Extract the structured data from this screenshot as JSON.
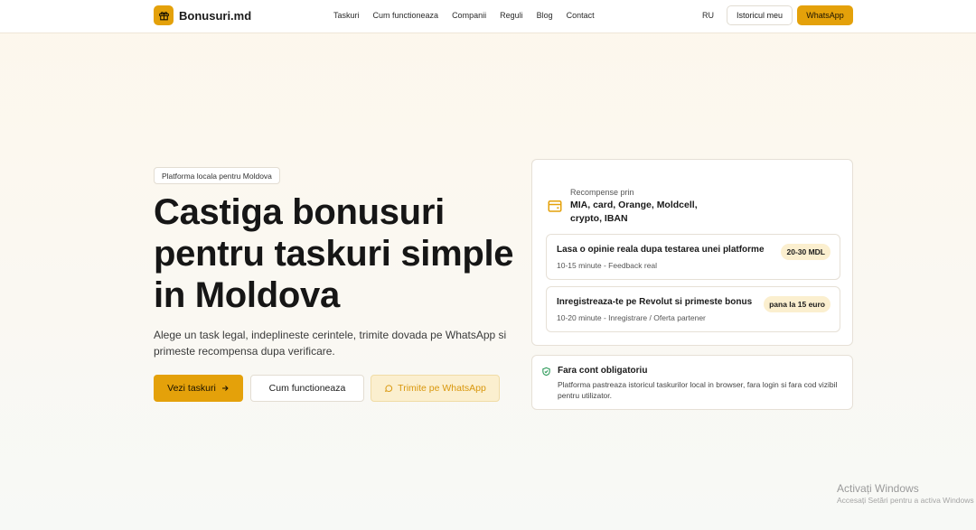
{
  "brand": {
    "name": "Bonusuri.md",
    "icon": "gift-icon",
    "accent": "#e4a10a"
  },
  "nav": {
    "items": [
      "Taskuri",
      "Cum functioneaza",
      "Companii",
      "Reguli",
      "Blog",
      "Contact"
    ],
    "lang": "RU",
    "history_label": "Istoricul meu",
    "whatsapp_label": "WhatsApp"
  },
  "hero": {
    "badge": "Platforma locala pentru Moldova",
    "title": "Castiga bonusuri pentru taskuri simple in Moldova",
    "subtitle": "Alege un task legal, indeplineste cerintele, trimite dovada pe WhatsApp si primeste recompensa dupa verificare.",
    "cta_primary": "Vezi taskuri",
    "cta_secondary": "Cum functioneaza",
    "cta_whatsapp": "Trimite pe WhatsApp"
  },
  "rewards": {
    "icon": "wallet-icon",
    "label": "Recompense prin",
    "methods": "MIA, card, Orange, Moldcell, crypto, IBAN"
  },
  "tasks": [
    {
      "title": "Lasa o opinie reala dupa testarea unei platforme",
      "meta": "10-15 minute - Feedback real",
      "reward": "20-30 MDL"
    },
    {
      "title": "Inregistreaza-te pe Revolut si primeste bonus",
      "meta": "10-20 minute - Inregistrare / Oferta partener",
      "reward": "pana la 15 euro"
    }
  ],
  "note": {
    "icon": "shield-check-icon",
    "title": "Fara cont obligatoriu",
    "text": "Platforma pastreaza istoricul taskurilor local in browser, fara login si fara cod vizibil pentru utilizator."
  },
  "watermark": {
    "title": "Activați Windows",
    "subtitle": "Accesați Setări pentru a activa Windows"
  }
}
